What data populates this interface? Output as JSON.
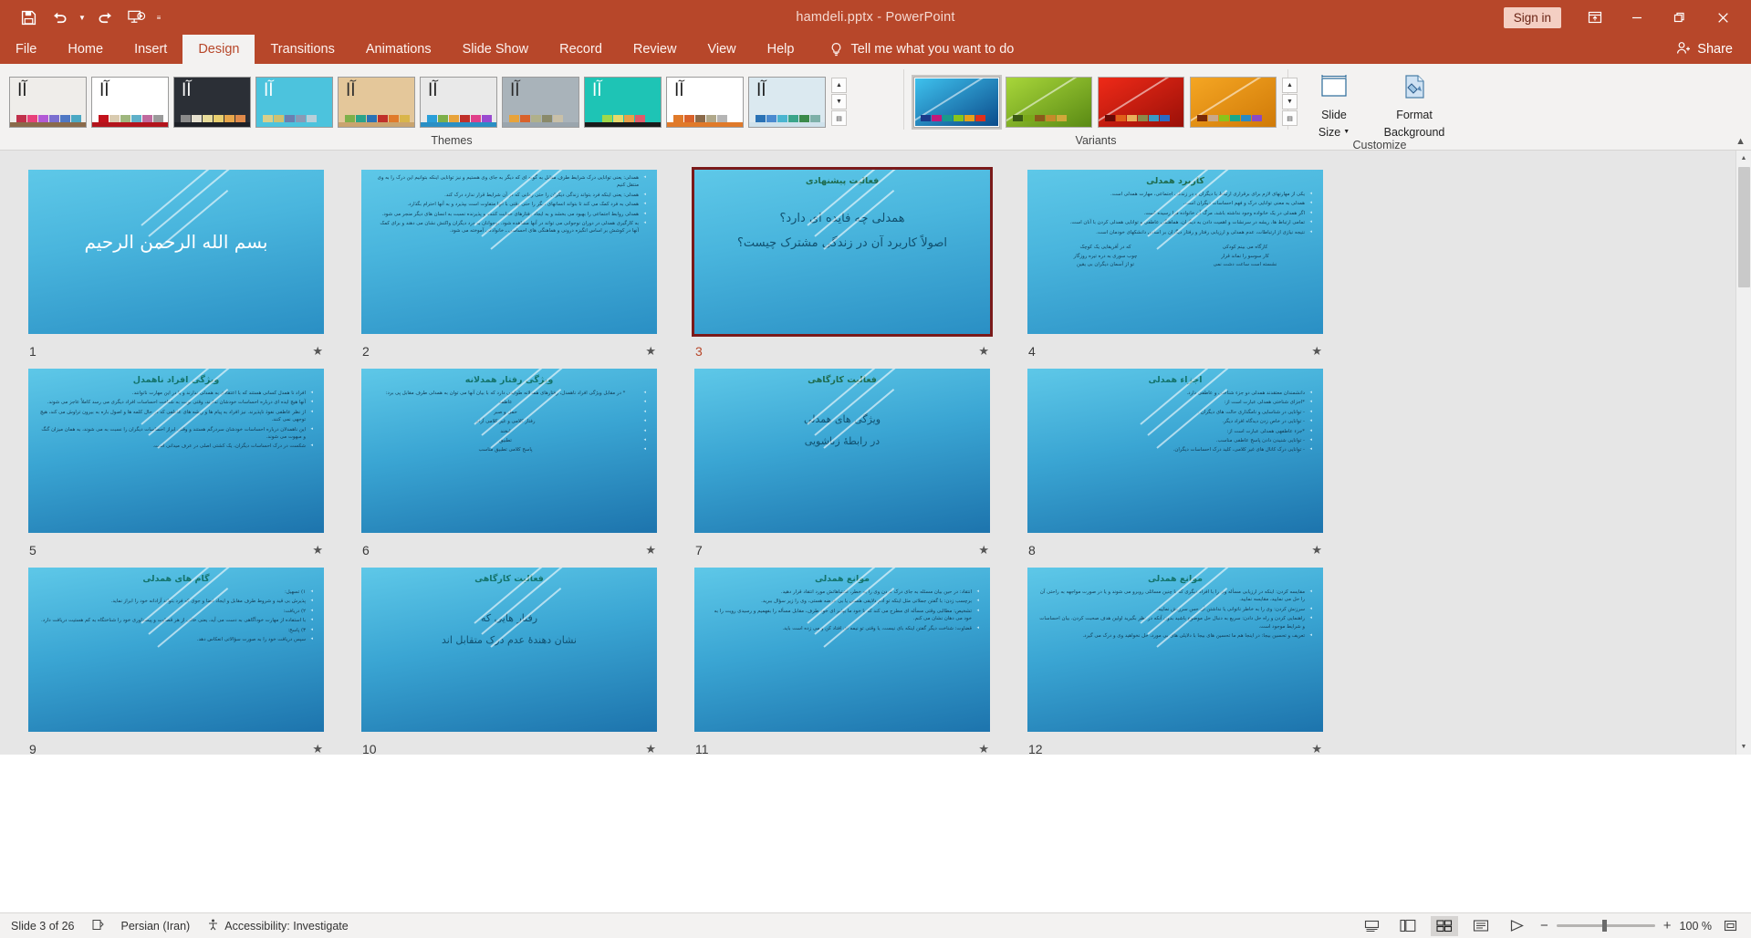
{
  "window": {
    "title": "hamdeli.pptx  -  PowerPoint",
    "sign_in": "Sign in",
    "ribbon_display_icon": "ribbon-display-options-icon",
    "minimize_icon": "minimize-icon",
    "restore_icon": "restore-icon",
    "close_icon": "close-icon",
    "accent_color": "#b7472a"
  },
  "quick_access": {
    "save_icon": "save-icon",
    "undo_icon": "undo-icon",
    "undo_dropdown_icon": "chevron-down-icon",
    "redo_icon": "redo-icon",
    "start_presentation_icon": "start-from-beginning-icon",
    "customize_icon": "customize-quick-access-toolbar-icon"
  },
  "tabs": [
    {
      "label": "File",
      "active": false
    },
    {
      "label": "Home",
      "active": false
    },
    {
      "label": "Insert",
      "active": false
    },
    {
      "label": "Design",
      "active": true
    },
    {
      "label": "Transitions",
      "active": false
    },
    {
      "label": "Animations",
      "active": false
    },
    {
      "label": "Slide Show",
      "active": false
    },
    {
      "label": "Record",
      "active": false
    },
    {
      "label": "Review",
      "active": false
    },
    {
      "label": "View",
      "active": false
    },
    {
      "label": "Help",
      "active": false
    }
  ],
  "tell_me": {
    "label": "Tell me what you want to do",
    "icon": "lightbulb-icon"
  },
  "share": {
    "label": "Share",
    "icon": "share-person-icon"
  },
  "ribbon": {
    "themes_group_label": "Themes",
    "variants_group_label": "Variants",
    "customize_group_label": "Customize",
    "themes": [
      {
        "name": "office-theme",
        "bg": "#efedea",
        "glyph_color": "#1a1a1a",
        "swatches": [
          "#c0304a",
          "#e8407a",
          "#b35ad6",
          "#7b6fd0",
          "#4f78c4",
          "#4aa8c4"
        ],
        "bottom": "#8a6a4a"
      },
      {
        "name": "berlin-theme",
        "bg": "#ffffff",
        "glyph_color": "#1a1a1a",
        "swatches": [
          "#c2121c",
          "#d9cbb0",
          "#9fb77e",
          "#5fb0c9",
          "#c06a9e",
          "#9a9a9a"
        ],
        "bottom": "#b3141c"
      },
      {
        "name": "ion-boardroom-theme",
        "bg": "#2b2f36",
        "glyph_color": "#ffffff",
        "swatches": [
          "#8a8a8a",
          "#e5e0cf",
          "#e8dc9a",
          "#e9cf6e",
          "#e8a64a",
          "#e08a4a"
        ],
        "bottom": "#1d2026"
      },
      {
        "name": "celestial-theme",
        "bg": "#4cc3dd",
        "glyph_color": "#ffffff",
        "swatches": [
          "#d9cf8a",
          "#cfc071",
          "#6a7fb0",
          "#8a9ab5",
          "#b8cfd9"
        ],
        "bottom": "#4cc3dd"
      },
      {
        "name": "wisp-theme",
        "bg": "#e4c79a",
        "glyph_color": "#2a2a2a",
        "swatches": [
          "#7db04a",
          "#2aa38a",
          "#2a72b5",
          "#c0302a",
          "#e07a2a",
          "#d9b54a"
        ],
        "bottom": "#c9a46f"
      },
      {
        "name": "facet-theme",
        "bg": "#e9e9e9",
        "glyph_color": "#1a1a1a",
        "swatches": [
          "#2a9fd9",
          "#7db04a",
          "#e8a33a",
          "#c0302a",
          "#e0408a",
          "#9a4ad0"
        ],
        "bottom": "#2a8fc4"
      },
      {
        "name": "slice-theme",
        "bg": "#a9b3ba",
        "glyph_color": "#2a2a2a",
        "swatches": [
          "#e8a33a",
          "#d9622a",
          "#b0b08a",
          "#8a8a6a",
          "#c9c0a8"
        ],
        "bottom": "#9aa5ad"
      },
      {
        "name": "retrospect-theme",
        "bg": "#1ec4b5",
        "glyph_color": "#ffffff",
        "swatches": [
          "#1ec4b5",
          "#9fd94a",
          "#e8d96a",
          "#e8a04a",
          "#e05a6a"
        ],
        "bottom": "#1a1a1a"
      },
      {
        "name": "basis-theme",
        "bg": "#ffffff",
        "glyph_color": "#1a1a1a",
        "swatches": [
          "#e07a2a",
          "#d9622a",
          "#8a6a4a",
          "#b0a88a",
          "#b5b5b5"
        ],
        "bottom": "#e07a2a"
      },
      {
        "name": "frame-theme",
        "bg": "#dbe9f0",
        "glyph_color": "#1a1a1a",
        "swatches": [
          "#2a72b5",
          "#4a8ad0",
          "#4ab5d0",
          "#3aa58a",
          "#3a8a4a",
          "#7db0a8"
        ],
        "bottom": "#cfe2ec"
      }
    ],
    "theme_scroll": {
      "up_icon": "scroll-up-icon",
      "down_icon": "scroll-down-icon",
      "more_icon": "more-themes-icon"
    },
    "variants": [
      {
        "name": "variant-blue",
        "c1": "#3fc3ef",
        "c2": "#0b4a8a",
        "selected": true,
        "swatches": [
          "#1b3a8a",
          "#c4187a",
          "#1a9a8a",
          "#8ac41a",
          "#e8a01a",
          "#e0301a"
        ]
      },
      {
        "name": "variant-green",
        "c1": "#a8d63a",
        "c2": "#5a8a14",
        "selected": false,
        "swatches": [
          "#3a5a14",
          "#7aa81a",
          "#8a5a1a",
          "#c48a2a",
          "#d0a83a"
        ]
      },
      {
        "name": "variant-red",
        "c1": "#ef2a18",
        "c2": "#9a1008",
        "selected": false,
        "swatches": [
          "#6a0a06",
          "#e0601a",
          "#e8b05a",
          "#8a8a4a",
          "#3a9ac4",
          "#2a6ac4"
        ]
      },
      {
        "name": "variant-orange",
        "c1": "#f5a623",
        "c2": "#d07a08",
        "selected": false,
        "swatches": [
          "#7a2a08",
          "#c9a88a",
          "#8ac41a",
          "#1aa88a",
          "#2a8ac4",
          "#8a4ac4"
        ]
      }
    ],
    "variant_scroll": {
      "up_icon": "scroll-up-icon",
      "down_icon": "scroll-down-icon",
      "more_icon": "more-variants-icon"
    },
    "slide_size": {
      "label_line1": "Slide",
      "label_line2": "Size",
      "icon": "slide-size-icon",
      "dropdown_icon": "chevron-down-icon"
    },
    "format_background": {
      "label_line1": "Format",
      "label_line2": "Background",
      "icon": "format-background-icon"
    },
    "collapse_icon": "collapse-ribbon-icon"
  },
  "slides": [
    {
      "number": "1",
      "selected": false,
      "layout": "big-center",
      "title": "",
      "lines": [
        "بسم الله الرحمن الرحیم"
      ],
      "star": "animation-star-icon"
    },
    {
      "number": "2",
      "selected": false,
      "layout": "bullets",
      "title": "",
      "bullets": [
        "همدلی: یعنی توانایی درک شرایط طرف مقابل به گونه ای که دیگر به جای وی هستیم و نیز توانایی اینکه بتوانیم این درک را به وی منتقل کنیم",
        "همدلی: یعنی اینکه فرد بتواند زندگی دیگران را حتی زمانی که در آن شرایط قرار ندارد درک کند.",
        "همدلی به فرد کمک می کند تا بتواند انسانهای دیگر را حتی وقتی با آنها متفاوت است بپذیرد و به آنها احترام بگذارد.",
        "همدلی روابط اجتماعی را بهبود می بخشد و به ایجاد رفتارهای حمایت کننده و پذیرنده نسبت به انسان های دیگر منجر می شود.",
        "به کارگیری همدلی در دوران نوجوانی می تواند در آنها مشاهده شود. نوجوانان به درد دیگران واکنش نشان می دهند و برای کمک آنها در کوشش بر اساس انگیزه درونی و هماهنگی های احساسی ـ خانوادگی آموخته می شود."
      ],
      "star": "animation-star-icon"
    },
    {
      "number": "3",
      "selected": true,
      "layout": "title-big",
      "title": "فعالیت پیشنهادی",
      "lines": [
        "همدلی چه فایده ای دارد؟",
        "اصولاً کاربرد آن در زندگی مشترک چیست؟"
      ],
      "star": "animation-star-icon"
    },
    {
      "number": "4",
      "selected": false,
      "layout": "bullets-two-col",
      "title": "کاربرد همدلی",
      "bullets": [
        "یکی از مهارتهای لازم برای برقراری ارتباط با دیگران و در زندگی اجتماعی، مهارت همدلی است.",
        "همدلی به معنی توانایی درک و فهم احساسات دیگران است.",
        "اگر همدلی در یک خانواده وجود نداشته باشد، مرگ آن خانواده فرا رسیده است.",
        "تمامی ارتباط ها، ریشه در سرنشات و اهمیت دادن به دیگران، هماهنگی عاطفی و توانایی همدلی کردن با آنان است.",
        "نتیجه نیازی از ارتباطات، عدم همدلی و ارزیابی رفتار و رفتار دیگران بر اساس دانشکهای خودمان است."
      ],
      "columns": [
        [
          "کارگاه می بینم کودکی",
          "کار سوسو را نماند قرار",
          "نشسته است ساعت دشت نمی"
        ],
        [
          "که در آفریقایی یک کوچک",
          "چوب سوری به دره تیره روزگار",
          "تو از آسمان دیگران بی یقین"
        ]
      ],
      "star": "animation-star-icon"
    },
    {
      "number": "5",
      "selected": false,
      "layout": "bullets",
      "title": "ویژگی افراد ناهمدل",
      "bullets": [
        "افراد نا همدل کسانی هستند که با اعتقادی به همدلی ندارند و یا در این مهارت ناتوانند.",
        "آنها هیچ ایده ای درباره احساسات خودشان ندارند، وقتی نوبت به شناخت احساسات افراد دیگری می رسد کاملاً عاجز می شوند.",
        "از نظر عاطفی نفوذ ناپذیرند. نیز افراد به پیام ها و ریشه های عاطفی که در حال کلمه ها و اصول باره به بیرون تراوش می کند، هیچ توجهی نمی کنند.",
        "این ناهمدلان درباره احساسات خودشان سردرگم هستند و وقتی ابراز احساسات دیگران را نسبت به می شوند، به همان میزان گنگ و مبهوت می شوند.",
        "شکست در درک احساسات دیگران، یک کشتی اصلی در عرف میدانی است."
      ],
      "star": "animation-star-icon"
    },
    {
      "number": "6",
      "selected": false,
      "layout": "bullets-centered",
      "title": "ویژگی رفتار همدلانه",
      "bullets": [
        "* در مقابل ویژگی افراد ناهمدل، رفتارهای همدلانه طوایفی دارد که با بیان آنها می توان به همدلی طرف مقابل پی برد:",
        "عاطفه",
        "حمل و صبر",
        "رفتار کلامی و غیر کلامی آرام",
        "لبخند",
        "تطبیق",
        "پاسخ کلامی تطبیق مناسب"
      ],
      "star": "animation-star-icon"
    },
    {
      "number": "7",
      "selected": false,
      "layout": "title-mid",
      "title": "فعالیت کارگاهی",
      "lines": [
        "ویژگی های همدلی",
        "در رابطهٔ زناشویی"
      ],
      "star": "animation-star-icon"
    },
    {
      "number": "8",
      "selected": false,
      "layout": "bullets",
      "title": "اجزاء همدلی",
      "bullets": [
        "دانشمندان معتقدند همدلی دو جزء شناختی و عاطفی دارد.",
        "*اجزای شناختی همدلی عبارت است از:",
        "- توانایی در شناسایی و نامگذاری حالت های دیگران ،",
        "- توانایی در خاص زدن دیدگاه افراد دیگر.",
        "*جزء عاطفهی همدلی عبارت است از:",
        "- توانایی شنیدن دادن پاسخ عاطفی مناسب.",
        "- توانایی درک کانال های غیر کلامی، کلید درک احساسات دیگران."
      ],
      "star": "animation-star-icon"
    },
    {
      "number": "9",
      "selected": false,
      "layout": "bullets",
      "title": "گام های همدلی",
      "bullets": [
        "۱) تسهیل:",
        "پذیرش بی قید و شروط طرف مقابل و ایجاد فضا و جوی که فرد بتواند آزادانه خود را ابراز نماید.",
        "۲) دریافت:",
        "با استفاده از مهارت خودآگاهی به دست می آید، یعنی خالی از هر قضاوت و پیشداوری خود را شناختگاه به کم هستیت دریافت دارد.",
        "۳) پاسخ:",
        "سپس دریافت خود را به صورت سؤالاتی انعکاس دهد."
      ],
      "star": "animation-star-icon"
    },
    {
      "number": "10",
      "selected": false,
      "layout": "title-mid",
      "title": "فعالیت کارگاهی",
      "lines": [
        "رفتار هایی که",
        "نشان دهندهٔ عدم درک متقابل اند"
      ],
      "star": "animation-star-icon"
    },
    {
      "number": "11",
      "selected": false,
      "layout": "bullets",
      "title": "موانع همدلی",
      "bullets": [
        "انتقاد: در حین بیان مسئله به جای درک کردن وی را به خطر، اشتباهاتش مورد انتقاد قرار دهید.",
        "برچسب زدن: با گفتن جملاتی مثل اینکه تو آدم دلایقی هستی یا بی عرضه هستی، وی را زیر سؤال ببرید.",
        "تشخیص: مطالبی وقتی مسأله ای مطرح می کند که با خود ما بپذیر ای خود طرف، مقابل مسأله را بفهمیم و رسیدی رویت را به خود می دهان نشان می کنم.",
        "قضاوت: شناخت دیگر گفتن اینکه بای نیست، یا وقتی تو نیمه ای افتاد کن و می زده است باید."
      ],
      "star": "animation-star-icon"
    },
    {
      "number": "12",
      "selected": false,
      "layout": "bullets",
      "title": "موانع همدلی",
      "bullets": [
        "مقایسه کردن: اینکه در ارزیابی مسأله وی را با افراد دیگری که با چنین مسائلی روبرو می شوند و یا در صورت مواجهه به راحتی آن را حل می نمایید، مقایسه نمایید.",
        "سرزنش کردن: وی را به خاطر ناتوانی یا نداشتن آن حس سرزنش نمایید.",
        "راهنمایی کردن و راه حل دادن: سریع به دنبال حل موضوع باشید بدون آنکه در نظر بگیرید اولین هدف صحبت کردن، بیان احساسات و شرایط موجود است.",
        "تعریف و تحسین بیجا: در اینجا هم ما تحسین های بیجا با دلایلی های بی مورد، حل نخواهید وی و درک می گیرد."
      ],
      "star": "animation-star-icon"
    }
  ],
  "status_bar": {
    "slide_count": "Slide 3 of 26",
    "language_icon": "spell-check-icon",
    "language": "Persian (Iran)",
    "accessibility_icon": "accessibility-icon",
    "accessibility": "Accessibility: Investigate",
    "notes_icon": "notes-icon",
    "views": [
      {
        "name": "normal-view",
        "icon": "normal-view-icon",
        "active": false
      },
      {
        "name": "slide-sorter-view",
        "icon": "slide-sorter-icon",
        "active": true
      },
      {
        "name": "reading-view",
        "icon": "reading-view-icon",
        "active": false
      },
      {
        "name": "slide-show-view",
        "icon": "slide-show-icon",
        "active": false
      }
    ],
    "zoom_out_icon": "zoom-out-icon",
    "zoom_in_icon": "zoom-in-icon",
    "zoom_value": "100 %",
    "fit_icon": "fit-to-window-icon"
  }
}
